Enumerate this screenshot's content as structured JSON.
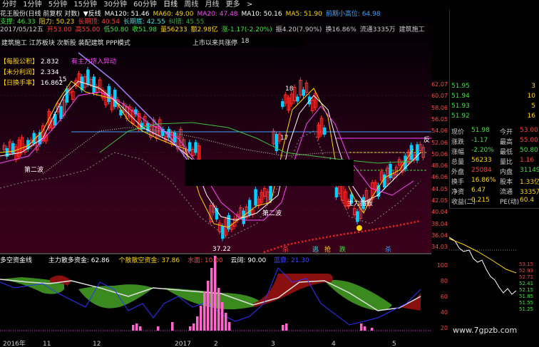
{
  "toolbar": {
    "periods": [
      "分时",
      "1分钟",
      "5分钟",
      "15分钟",
      "30分钟",
      "60分钟",
      "日线",
      "周线",
      "月线",
      "更多"
    ],
    "selected": "日线",
    "more_arrow": ">"
  },
  "info": {
    "line1": [
      {
        "text": "花王股份(日线 前复权 对数)",
        "color": "#e8e8e8"
      },
      {
        "text": "▼反线",
        "color": "#ffffff"
      },
      {
        "text": "MA120: 51.46",
        "color": "#ffffff"
      },
      {
        "text": "MA60: 49.00",
        "color": "#ffd700"
      },
      {
        "text": "MA20: 47.48",
        "color": "#ff44ff"
      },
      {
        "text": "MA10: 50.16",
        "color": "#ffffff"
      },
      {
        "text": "MA5: 51.90",
        "color": "#ffd700"
      },
      {
        "text": "前期小高位: 64.98",
        "color": "#40a0ff"
      }
    ],
    "line2": [
      {
        "text": "支撑: 46.33",
        "color": "#40e040"
      },
      {
        "text": "阻力: 50.23",
        "color": "#ffd700"
      },
      {
        "text": "长期顶: 40.54",
        "color": "#ff4040"
      },
      {
        "text": "长期底: 42.55",
        "color": "#40e0e0"
      },
      {
        "text": "纠错: 45.55",
        "color": "#40a040"
      }
    ],
    "line3": [
      {
        "text": "2017/05/12五",
        "color": "#cccccc"
      },
      {
        "text": "开53.00",
        "color": "#ff4040"
      },
      {
        "text": "高55.00",
        "color": "#ff4040"
      },
      {
        "text": "低50.80",
        "color": "#40e040"
      },
      {
        "text": "收51.98",
        "color": "#40e040"
      },
      {
        "text": "量56233",
        "color": "#ffd700"
      },
      {
        "text": "额2.98亿",
        "color": "#ffd700"
      },
      {
        "text": "涨-1.17(-2.20%)",
        "color": "#40e040"
      },
      {
        "text": "振4.20(7.90%)",
        "color": "#cccccc"
      },
      {
        "text": "换16.86%",
        "color": "#cccccc"
      },
      {
        "text": "流通3335万",
        "color": "#cccccc"
      },
      {
        "text": "建筑施工",
        "color": "#cccccc"
      }
    ]
  },
  "concept": {
    "text": "建筑施工 江苏板块 次新股 装配建筑 PPP模式",
    "rise_label": "上市以来共涨停",
    "rise_count": "18"
  },
  "panel": {
    "eps_label": "【每股公积】",
    "eps": "2.832",
    "undist_label": "【未分利润】",
    "undist": "2.334",
    "turn_label": "【日换手率】",
    "turn": "16.862"
  },
  "chart_labels": {
    "wave1": "第二波",
    "wave2": "第二波",
    "wave3": "主力抬板",
    "low": "37.22",
    "hi18": "18",
    "n17": "17",
    "bubble1": "有主力挤入异动",
    "n15": "15",
    "fan": "反",
    "bottom_marks": [
      "杀",
      "逃",
      "抢",
      "跌",
      "杀"
    ]
  },
  "price_axis": [
    "62.07",
    "60.07",
    "58.06",
    "56.05",
    "54.06",
    "52.06",
    "50.06",
    "48.06",
    "46.06",
    "44.05",
    "42.05",
    "40.04",
    "38.04",
    "36.04",
    "34.03"
  ],
  "quote": {
    "book": [
      [
        "51.95",
        "3"
      ],
      [
        "51.94",
        "10"
      ],
      [
        "51.93",
        "5"
      ],
      [
        "51.92",
        "16"
      ]
    ],
    "rows": [
      {
        "l1": "现价",
        "v1": "51.98",
        "l2": "今开",
        "v2": "53.00",
        "c1": "#40e040",
        "c2": "#ff4040"
      },
      {
        "l1": "涨跌",
        "v1": "-1.17",
        "l2": "最高",
        "v2": "55.00",
        "c1": "#40e040",
        "c2": "#ff4040"
      },
      {
        "l1": "涨幅",
        "v1": "-2.20%",
        "l2": "最低",
        "v2": "50.80",
        "c1": "#40e040",
        "c2": "#40e040"
      },
      {
        "l1": "总量",
        "v1": "56233",
        "l2": "量比",
        "v2": "1.16",
        "c1": "#ffd700",
        "c2": "#ff4040"
      },
      {
        "l1": "外盘",
        "v1": "25084",
        "l2": "内盘",
        "v2": "31149",
        "c1": "#ff4040",
        "c2": "#40e040"
      },
      {
        "l1": "换手",
        "v1": "16.86%",
        "l2": "股本",
        "v2": "1.33亿",
        "c1": "#ffd700",
        "c2": "#ffd700"
      },
      {
        "l1": "净资",
        "v1": "6.47",
        "l2": "流通",
        "v2": "3335万",
        "c1": "#ffd700",
        "c2": "#ffd700"
      },
      {
        "l1": "收益(二)",
        "v1": "0.215",
        "l2": "PE(动)",
        "v2": "60.4",
        "c1": "#ffd700",
        "c2": "#ffd700"
      }
    ],
    "mini_title": "花王股份",
    "mini_price": "51.98",
    "mini_change": "-2.20%",
    "mini_axis": [
      "53.15",
      "52.93",
      "52.71",
      "52.41",
      "52.15",
      "51.85",
      "51.55",
      "51.25"
    ],
    "right_scale": [
      "60.4",
      "58.4",
      "56.4",
      "54.3",
      "52.3",
      "50.3",
      "48.3"
    ]
  },
  "sub": {
    "title": "多空资金线",
    "main_label": "主力散多资金: 62.86",
    "retail_label": "个散散空资金: 37.86",
    "water_label": "水面: 10.00",
    "cloud_label": "云阔: 90.00",
    "lan_label": "蓝鼎: 21.30"
  },
  "dates": [
    "2016年",
    "11",
    "12",
    "2017",
    "2",
    "3",
    "4",
    "5"
  ],
  "watermark": "www.7gpzb.com",
  "colors": {
    "up": "#ff4040",
    "down": "#00e0ff",
    "ma5": "#ffd700",
    "ma10": "#ffffff",
    "ma20": "#ff44ff",
    "ma60": "#40c040",
    "ma120": "#ffffff"
  }
}
